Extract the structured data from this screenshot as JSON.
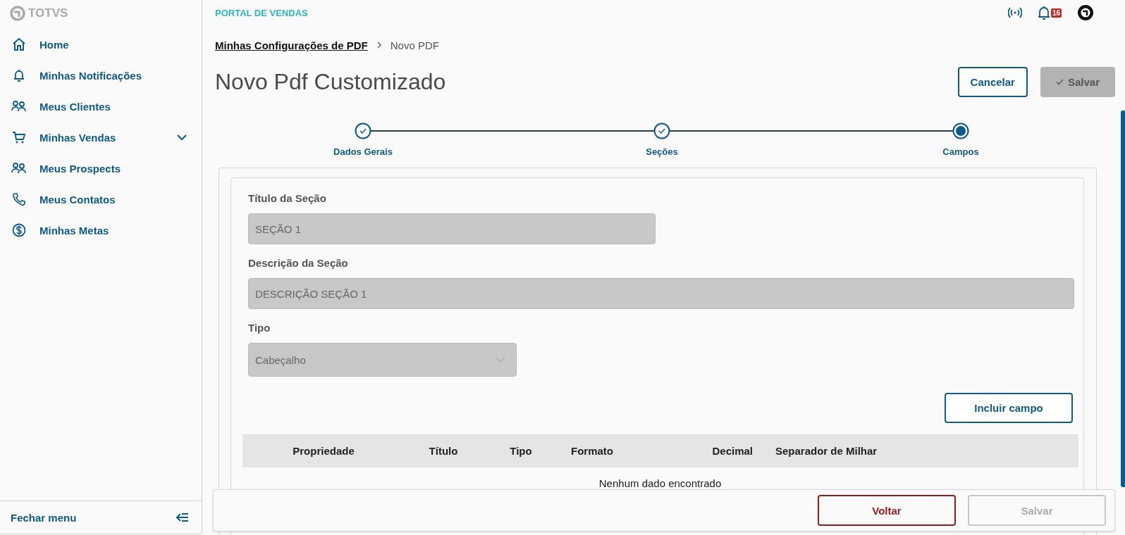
{
  "sidebar": {
    "logo": "TOTVS",
    "items": [
      {
        "label": "Home",
        "expandable": false
      },
      {
        "label": "Minhas Notificações",
        "expandable": false
      },
      {
        "label": "Meus Clientes",
        "expandable": false
      },
      {
        "label": "Minhas Vendas",
        "expandable": true
      },
      {
        "label": "Meus Prospects",
        "expandable": false
      },
      {
        "label": "Meus Contatos",
        "expandable": false
      },
      {
        "label": "Minhas Metas",
        "expandable": false
      }
    ],
    "footer": "Fechar menu"
  },
  "header": {
    "title": "PORTAL DE VENDAS",
    "notification_count": "16"
  },
  "breadcrumb": [
    {
      "label": "Minhas Configurações de PDF",
      "link": true
    },
    {
      "label": "Novo PDF",
      "link": false
    }
  ],
  "page_title": "Novo Pdf Customizado",
  "actions": [
    {
      "label": "Cancelar",
      "disabled": false
    },
    {
      "label": "Salvar",
      "disabled": true
    }
  ],
  "stepper": [
    {
      "label": "Dados Gerais",
      "kind": "done"
    },
    {
      "label": "Seções",
      "kind": "done"
    },
    {
      "label": "Campos",
      "kind": "active"
    }
  ],
  "form": {
    "fields": [
      {
        "label": "Título da Seção",
        "value": "SEÇÃO 1",
        "kind": "text",
        "disabled": true
      },
      {
        "label": "Descrição da Seção",
        "value": "DESCRIÇÃO SEÇÃO 1",
        "kind": "text",
        "disabled": true
      },
      {
        "label": "Tipo",
        "value": "Cabeçalho",
        "kind": "select",
        "disabled": true
      }
    ],
    "add_button": "Incluir campo"
  },
  "table": {
    "columns": [
      "Propriedade",
      "Título",
      "Tipo",
      "Formato",
      "Decimal",
      "Separador de Milhar"
    ],
    "empty_text": "Nenhum dado encontrado"
  },
  "footer": {
    "buttons": [
      {
        "label": "Voltar",
        "disabled": false
      },
      {
        "label": "Salvar",
        "disabled": true
      }
    ]
  }
}
